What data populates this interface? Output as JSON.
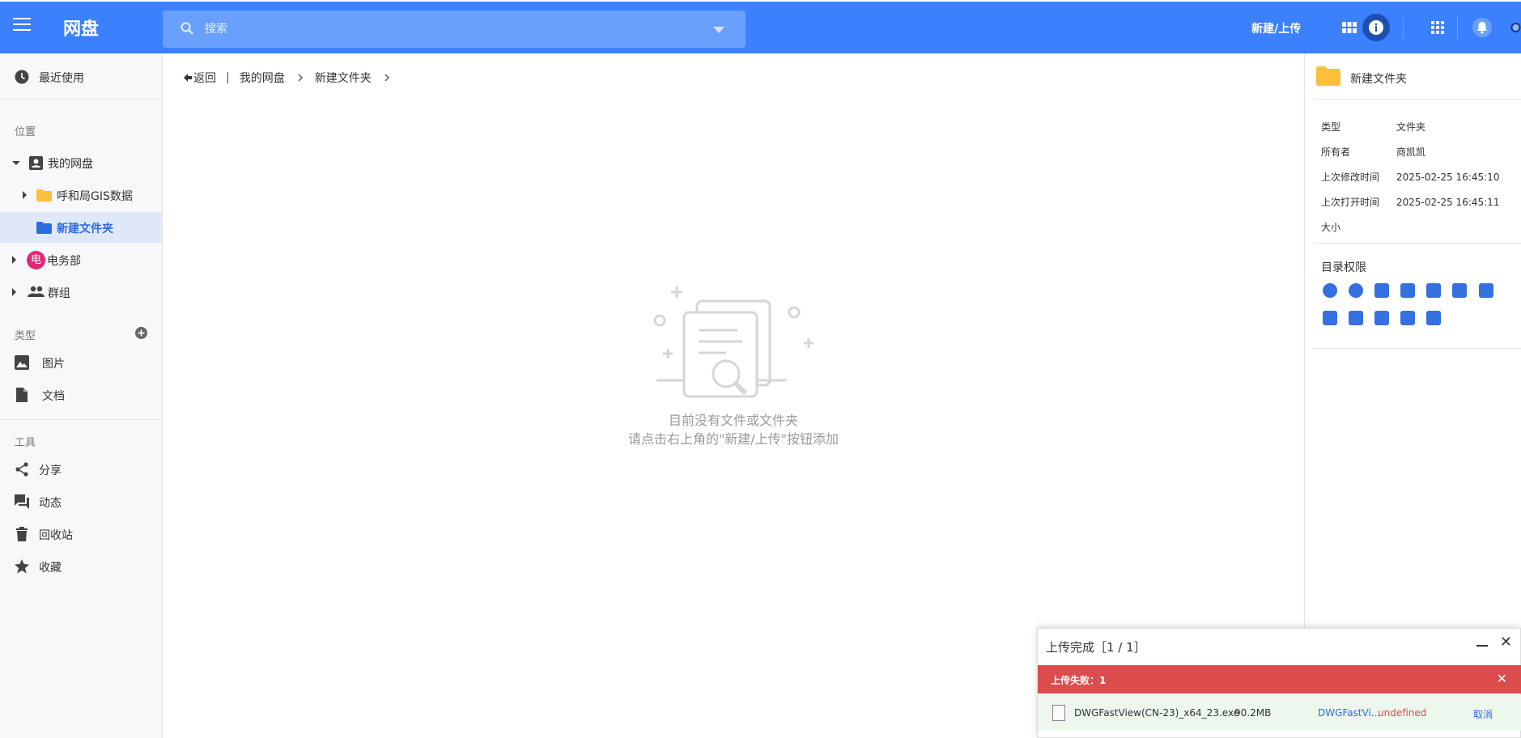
{
  "header": {
    "brand": "网盘",
    "search_placeholder": "搜索",
    "new_upload_label": "新建/上传"
  },
  "sidebar": {
    "recent": "最近使用",
    "location_title": "位置",
    "my_drive": "我的网盘",
    "folder_gis": "呼和局GIS数据",
    "folder_new": "新建文件夹",
    "dept_avatar": "电",
    "dept": "电务部",
    "groups": "群组",
    "type_title": "类型",
    "images": "图片",
    "docs": "文档",
    "tools_title": "工具",
    "share": "分享",
    "activity": "动态",
    "recycle": "回收站",
    "favorites": "收藏"
  },
  "breadcrumb": {
    "back": "返回",
    "divider": "|",
    "my_drive": "我的网盘",
    "current": "新建文件夹"
  },
  "empty": {
    "line1": "目前没有文件或文件夹",
    "line2": "请点击右上角的\"新建/上传\"按钮添加"
  },
  "details": {
    "name": "新建文件夹",
    "type_label": "类型",
    "type_value": "文件夹",
    "owner_label": "所有者",
    "owner_value": "商凯凯",
    "modified_label": "上次修改时间",
    "modified_value": "2025-02-25 16:45:10",
    "opened_label": "上次打开时间",
    "opened_value": "2025-02-25 16:45:11",
    "size_label": "大小",
    "perm_title": "目录权限"
  },
  "upload": {
    "title": "上传完成［1 / 1］",
    "fail_text": "上传失败：1",
    "file_name": "DWGFastView(CN-23)_x64_23.exe",
    "file_size": "90.2MB",
    "dest": "DWGFastVi...",
    "status": "undefined",
    "cancel": "取消"
  },
  "colors": {
    "primary": "#3b80fd",
    "folder": "#fbbf3c",
    "danger": "#dc4c4c",
    "success_bg": "#edf7ee"
  }
}
